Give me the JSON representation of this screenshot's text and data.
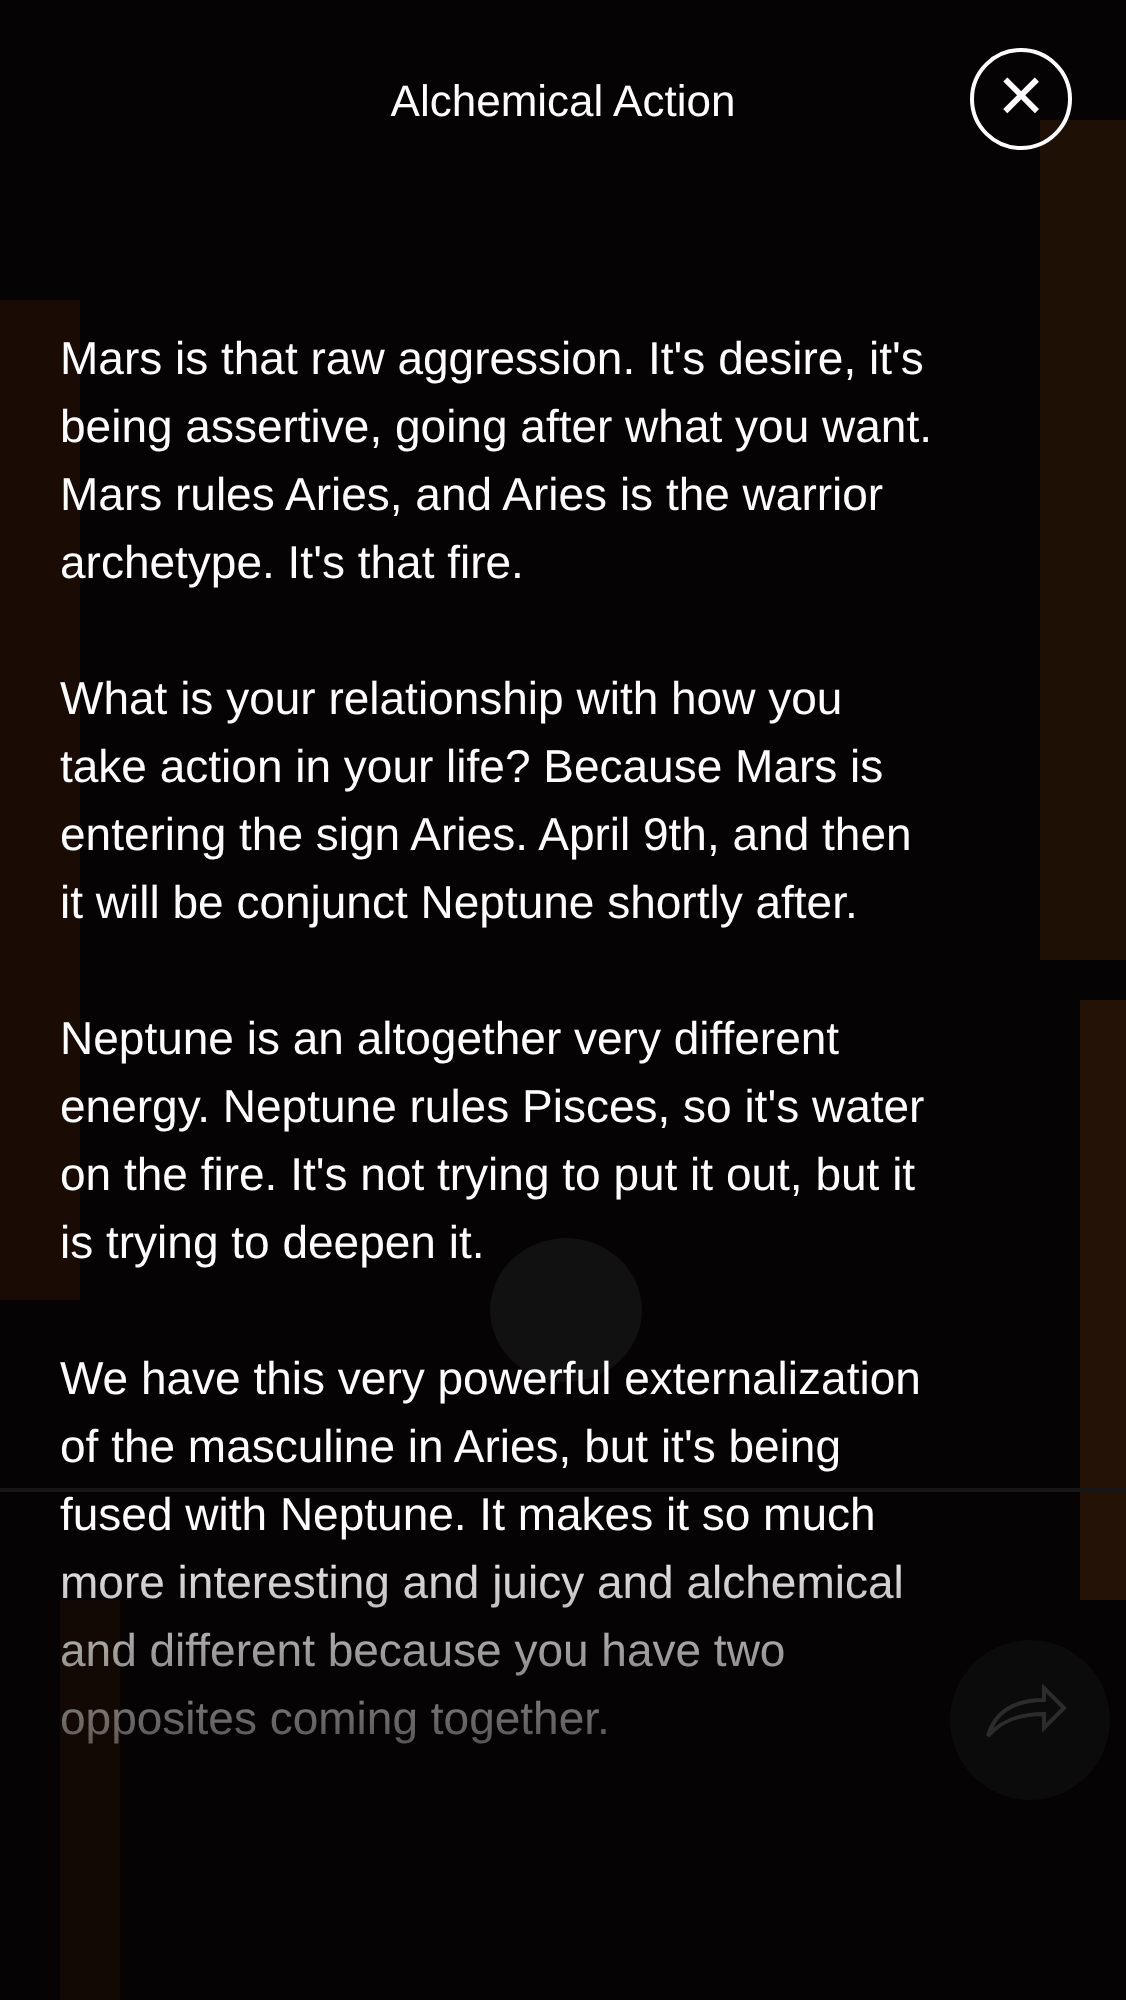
{
  "overlay": {
    "title": "Alchemical Action",
    "close_label": "×",
    "paragraphs": [
      "Mars is that raw aggression. It's desire, it's being assertive, going after what you want. Mars rules Aries, and Aries is the warrior archetype. It's that fire.",
      "What is your relationship with how you take action in your life? Because Mars is entering the sign Aries. April 9th, and then it will be conjunct Neptune shortly after.",
      "Neptune is an altogether very different energy. Neptune rules Pisces, so it's water on the fire. It's not trying to put it out, but it is trying to deepen it.",
      "We have this very powerful externalization of the masculine in Aries, but it's being fused with Neptune. It makes it so much more interesting and juicy and alchemical and different because you have two opposites coming together."
    ]
  }
}
